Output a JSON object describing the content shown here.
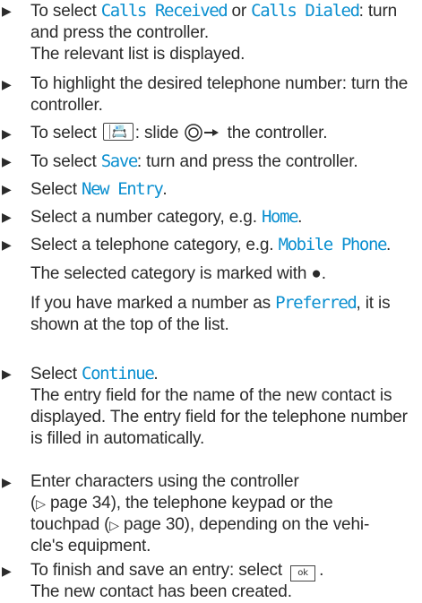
{
  "bullet_glyph": "▶",
  "steps": [
    {
      "pre1": "To select ",
      "ui1": "Calls Received",
      "mid1": " or ",
      "ui2": "Calls Dialed",
      "post1": ": turn and press the controller.",
      "result": "The relevant list is displayed."
    },
    {
      "text": "To highlight the desired telephone number: turn the controller."
    },
    {
      "pre": "To select ",
      "key_icon_name": "phonebook-menu-icon",
      "mid": ": slide ",
      "controller_icon_name": "controller-slide-right-icon",
      "post": " the controller."
    },
    {
      "pre": "To select ",
      "ui": "Save",
      "post": ": turn and press the controller."
    },
    {
      "pre": "Select ",
      "ui": "New Entry",
      "post": "."
    },
    {
      "pre": "Select a number category, e.g. ",
      "ui": "Home",
      "post": "."
    },
    {
      "pre": "Select a telephone category, e.g. ",
      "ui": "Mobile Phone",
      "post": ".",
      "result1": "The selected category is marked with ●.",
      "result2_pre": "If you have marked a number as ",
      "result2_ui": "Preferred",
      "result2_post": ", it is shown at the top of the list."
    },
    {
      "pre": "Select ",
      "ui": "Continue",
      "post": ".",
      "result": "The entry field for the name of the new contact is displayed. The entry field for the telephone number is filled in automatically."
    },
    {
      "line1": "Enter characters using the controller",
      "line2_pre": "(",
      "ref_glyph": "▷",
      "page_ref1": " page 34), the telephone keypad or the",
      "line3_pre": "touchpad (",
      "page_ref2": " page 30), depending on the vehi-",
      "line4": "cle's equipment."
    },
    {
      "pre": "To finish and save an entry: select ",
      "key": "ok",
      "post": ".",
      "result": "The new contact has been created."
    }
  ],
  "colors": {
    "ui_text": "#0a8fd0",
    "body_text": "#2b2b2b"
  }
}
